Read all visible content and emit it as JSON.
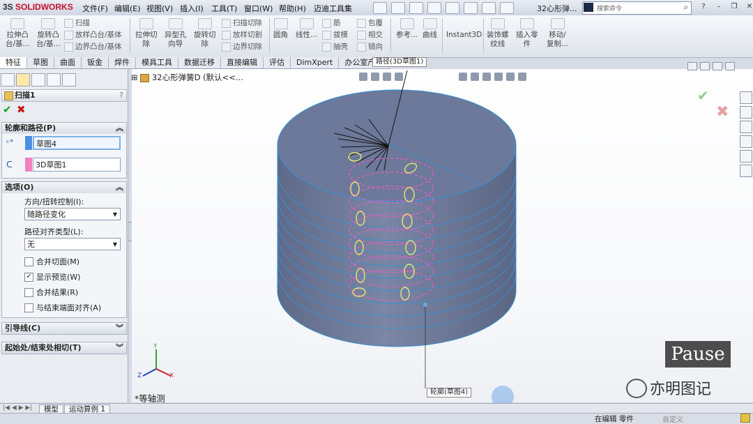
{
  "app": {
    "logo_brand": "SOLIDWORKS",
    "logo_prefix": "3S"
  },
  "menu": [
    "文件(F)",
    "编辑(E)",
    "视图(V)",
    "插入(I)",
    "工具(T)",
    "窗口(W)",
    "帮助(H)",
    "迈迪工具集"
  ],
  "doc_title": "32心形弹...",
  "command_search": {
    "placeholder": "搜索命令"
  },
  "ribbon": {
    "big_buttons": [
      {
        "label1": "拉伸凸",
        "label2": "台/基..."
      },
      {
        "label1": "旋转凸",
        "label2": "台/基..."
      },
      {
        "label1": "拉伸切",
        "label2": "除"
      },
      {
        "label1": "异型孔",
        "label2": "向导"
      },
      {
        "label1": "旋转切",
        "label2": "除"
      },
      {
        "label1": "圆角",
        "label2": ""
      },
      {
        "label1": "线性...",
        "label2": ""
      },
      {
        "label1": "参考...",
        "label2": ""
      },
      {
        "label1": "曲线",
        "label2": ""
      },
      {
        "label1": "Instant3D",
        "label2": ""
      },
      {
        "label1": "装饰螺",
        "label2": "纹线"
      },
      {
        "label1": "插入零",
        "label2": "件"
      },
      {
        "label1": "移动/",
        "label2": "复制..."
      }
    ],
    "small_group1": [
      "扫描",
      "放样凸台/基体",
      "边界凸台/基体"
    ],
    "small_group2": [
      "扫描切除",
      "放样切割",
      "边界切除"
    ],
    "small_group3": [
      "筋",
      "拔模",
      "抽壳"
    ],
    "small_group4": [
      "包覆",
      "相交",
      "镜向"
    ]
  },
  "tabs": [
    "特征",
    "草图",
    "曲面",
    "钣金",
    "焊件",
    "模具工具",
    "数据迁移",
    "直接编辑",
    "评估",
    "DimXpert",
    "办公室产品"
  ],
  "property_manager": {
    "title": "扫描1",
    "help": "?",
    "group_profile": {
      "header": "轮廓和路径(P)",
      "profile_value": "草图4",
      "path_value": "3D草图1"
    },
    "group_options": {
      "header": "选项(O)",
      "orient_label": "方向/扭转控制(I):",
      "orient_value": "随路径变化",
      "align_label": "路径对齐类型(L):",
      "align_value": "无",
      "checkboxes": [
        {
          "label": "合并切面(M)",
          "checked": false
        },
        {
          "label": "显示预览(W)",
          "checked": true
        },
        {
          "label": "合并结果(R)",
          "checked": false
        },
        {
          "label": "与结束端面对齐(A)",
          "checked": false
        }
      ]
    },
    "group_guides": {
      "header": "引导线(C)"
    },
    "group_tangency": {
      "header": "起始处/结束处相切(T)"
    }
  },
  "viewport": {
    "tree_label": "32心形弹簧D  (默认<<...",
    "callout_path": "路径(3D草图1)",
    "callout_profile": "轮廓(草图4)",
    "view_name": "*等轴测",
    "pause": "Pause",
    "watermark": "亦明图记"
  },
  "bottom_tabs": [
    "模型",
    "运动算例 1"
  ],
  "status": {
    "text": "在编辑 零件",
    "custom": "自定义"
  },
  "colors": {
    "part": "#6e7a99",
    "part_edge": "#3a8fd0",
    "sketch_pink": "#e060c0",
    "sketch_yellow": "#e0e060",
    "accent": "#1e5fa8"
  }
}
